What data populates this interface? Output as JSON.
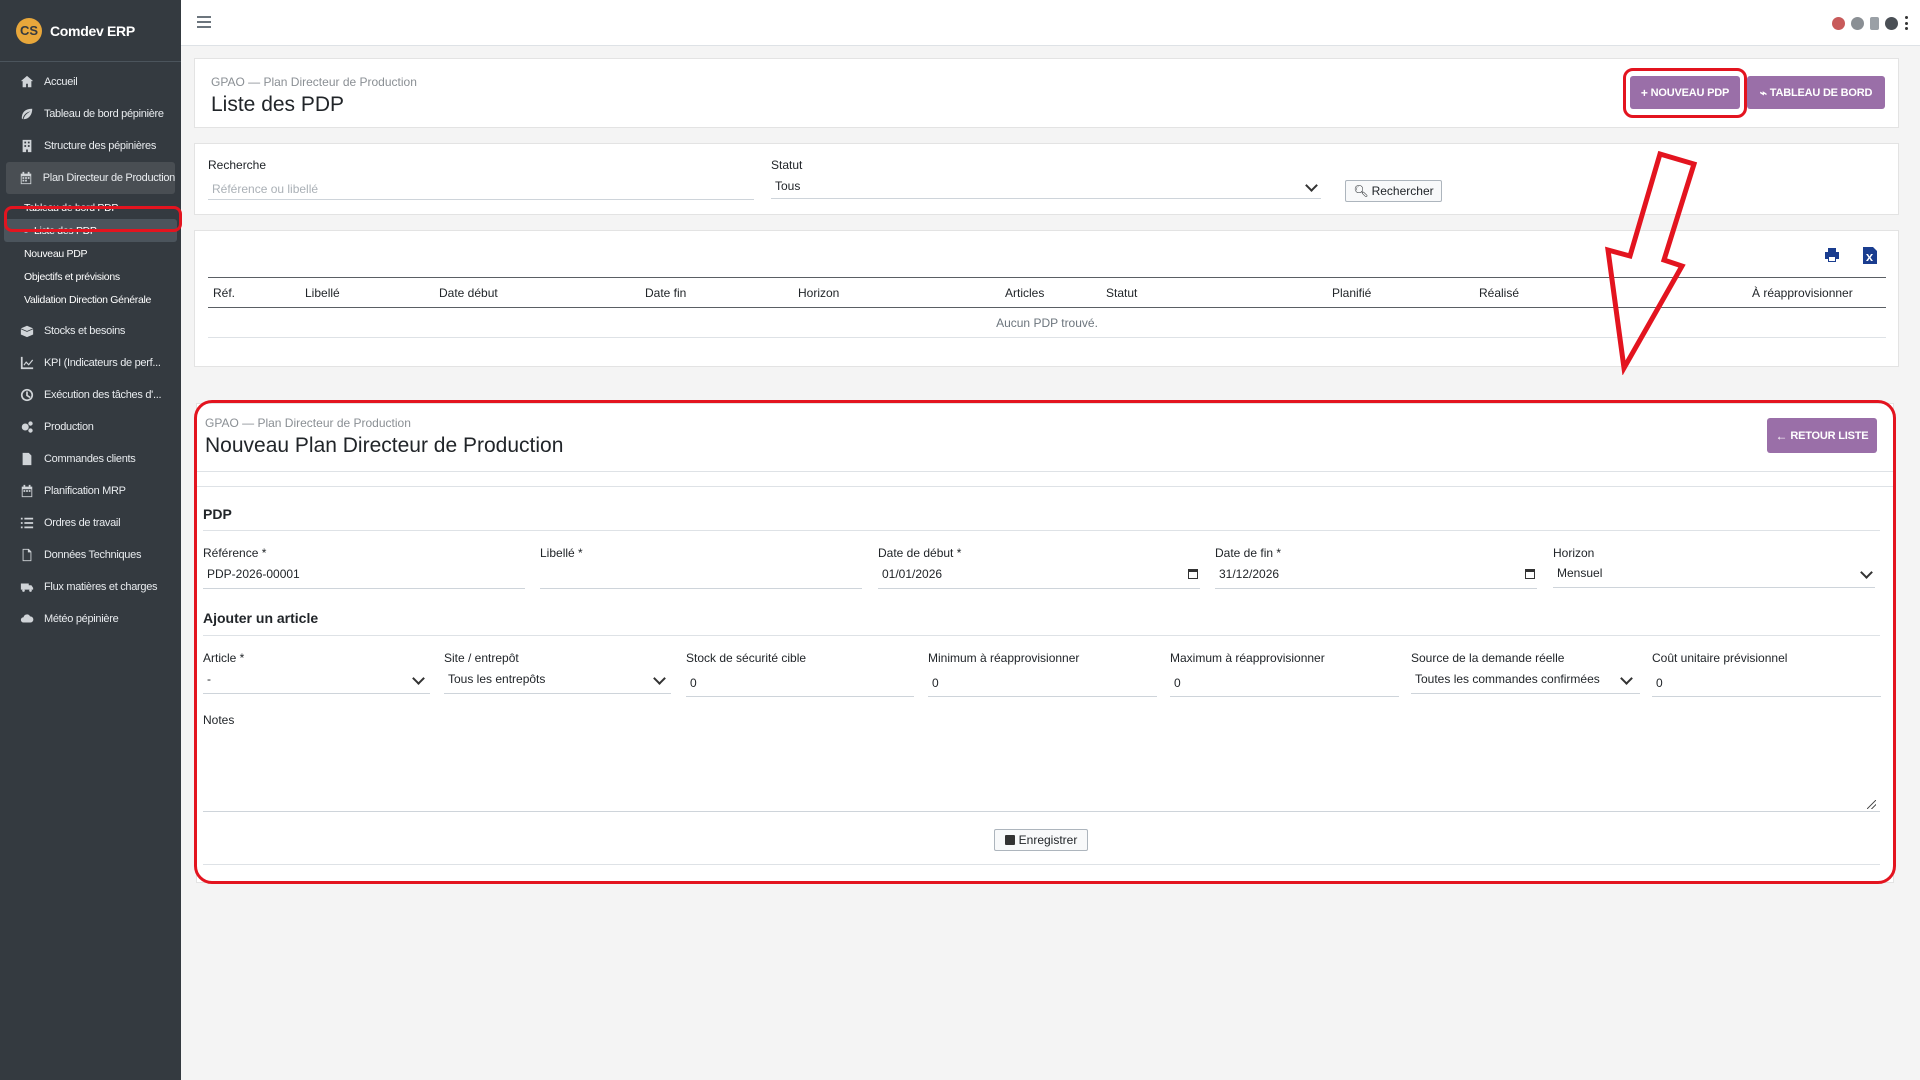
{
  "app": {
    "brand": "Comdev ERP",
    "logo_letters": "CS"
  },
  "sidebar": {
    "items": [
      {
        "label": "Accueil",
        "icon": "home-icon"
      },
      {
        "label": "Tableau de bord pépinière",
        "icon": "leaf-icon"
      },
      {
        "label": "Structure des pépinières",
        "icon": "building-icon"
      },
      {
        "label": "Plan Directeur de Production",
        "icon": "calendar-icon"
      },
      {
        "label": "Stocks et besoins",
        "icon": "boxes-icon"
      },
      {
        "label": "KPI (Indicateurs de perf...",
        "icon": "chart-icon"
      },
      {
        "label": "Exécution des tâches d'...",
        "icon": "clock-icon"
      },
      {
        "label": "Production",
        "icon": "cogs-icon"
      },
      {
        "label": "Commandes clients",
        "icon": "file-icon"
      },
      {
        "label": "Planification MRP",
        "icon": "calendar-icon"
      },
      {
        "label": "Ordres de travail",
        "icon": "list-icon"
      },
      {
        "label": "Données Techniques",
        "icon": "file-icon"
      },
      {
        "label": "Flux matières et charges",
        "icon": "truck-icon"
      },
      {
        "label": "Météo pépinière",
        "icon": "cloud-icon"
      }
    ],
    "subitems": [
      {
        "label": "Tableau de bord PDP"
      },
      {
        "label": "Liste des PDP"
      },
      {
        "label": "Nouveau PDP"
      },
      {
        "label": "Objectifs et prévisions"
      },
      {
        "label": "Validation Direction Générale"
      }
    ]
  },
  "list_page": {
    "breadcrumb": "GPAO — Plan Directeur de Production",
    "title": "Liste des PDP",
    "btn_new": "NOUVEAU PDP",
    "btn_dashboard": "TABLEAU DE BORD",
    "search": {
      "label": "Recherche",
      "placeholder": "Référence ou libellé",
      "status_label": "Statut",
      "status_value": "Tous",
      "btn": "Rechercher"
    },
    "table": {
      "columns": [
        "Réf.",
        "Libellé",
        "Date début",
        "Date fin",
        "Horizon",
        "Articles",
        "Statut",
        "Planifié",
        "Réalisé",
        "À réapprovisionner"
      ],
      "empty_text": "Aucun PDP trouvé."
    }
  },
  "form_page": {
    "breadcrumb": "GPAO — Plan Directeur de Production",
    "title": "Nouveau Plan Directeur de Production",
    "btn_back": "RETOUR LISTE",
    "section_pdp": "PDP",
    "fields": {
      "reference": {
        "label": "Référence *",
        "value": "PDP-2026-00001"
      },
      "libelle": {
        "label": "Libellé *",
        "value": ""
      },
      "date_debut": {
        "label": "Date de début *",
        "value": "01/01/2026"
      },
      "date_fin": {
        "label": "Date de fin *",
        "value": "31/12/2026"
      },
      "horizon": {
        "label": "Horizon",
        "value": "Mensuel"
      }
    },
    "section_article": "Ajouter un article",
    "article_fields": {
      "article": {
        "label": "Article *",
        "value": "-"
      },
      "site": {
        "label": "Site / entrepôt",
        "value": "Tous les entrepôts"
      },
      "stock_secu": {
        "label": "Stock de sécurité cible",
        "value": "0"
      },
      "min_reappro": {
        "label": "Minimum à réapprovisionner",
        "value": "0"
      },
      "max_reappro": {
        "label": "Maximum à réapprovisionner",
        "value": "0"
      },
      "source_demande": {
        "label": "Source de la demande réelle",
        "value": "Toutes les commandes confirmées"
      },
      "cout_unitaire": {
        "label": "Coût unitaire prévisionnel",
        "value": "0"
      }
    },
    "notes_label": "Notes",
    "btn_save": "Enregistrer"
  },
  "colors": {
    "sidebar": "#343a40",
    "accent_purple": "#9a6fa8",
    "annotation_red": "#e3141f"
  }
}
